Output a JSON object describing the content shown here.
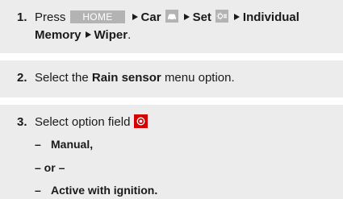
{
  "step1": {
    "number": "1.",
    "press": "Press",
    "home_button": "HOME",
    "car": "Car",
    "set": "Set",
    "individual": "Individual",
    "memory": "Memory",
    "wiper": "Wiper",
    "period": "."
  },
  "step2": {
    "number": "2.",
    "select": "Select the",
    "rain_sensor": "Rain sensor",
    "menu_option": "menu option."
  },
  "step3": {
    "number": "3.",
    "select_option_field": "Select option field",
    "dash": "–",
    "manual": "Manual,",
    "or": "– or –",
    "active": "Active with ignition."
  },
  "icons": {
    "car": "car-icon",
    "settings": "settings-icon",
    "option_field": "option-field-icon"
  },
  "colors": {
    "block_bg": "#ececec",
    "key_bg": "#b3b3b3",
    "option_red": "#d40000"
  }
}
